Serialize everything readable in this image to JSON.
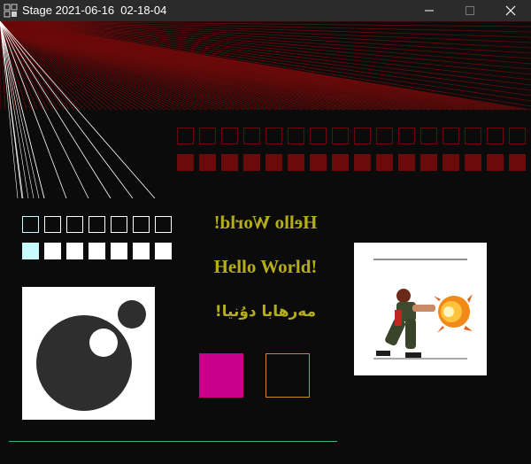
{
  "window": {
    "title": "Stage 2021-06-16  02-18-04",
    "icons": {
      "app": "app-grid-icon",
      "minimize": "minimize-icon",
      "maximize": "maximize-icon",
      "close": "close-icon"
    }
  },
  "stage": {
    "texts": {
      "mirrored": "Hello World!",
      "normal": "Hello World!",
      "uyghur": "مەرھابا دۇنيا!"
    },
    "colors": {
      "background": "#0b0b0b",
      "dark_red": "#6b0a0a",
      "text_yellow": "#b5ad1a",
      "white": "#ffffff",
      "cyan": "#c8fcfc",
      "magenta": "#c8008c",
      "orange_outline": "#d08a1a",
      "green_line": "#3fae7a",
      "dark_gray": "#2e2e2e"
    },
    "sprite_icon": "fighter-sprite-icon",
    "logo_icon": "circles-logo-icon"
  }
}
